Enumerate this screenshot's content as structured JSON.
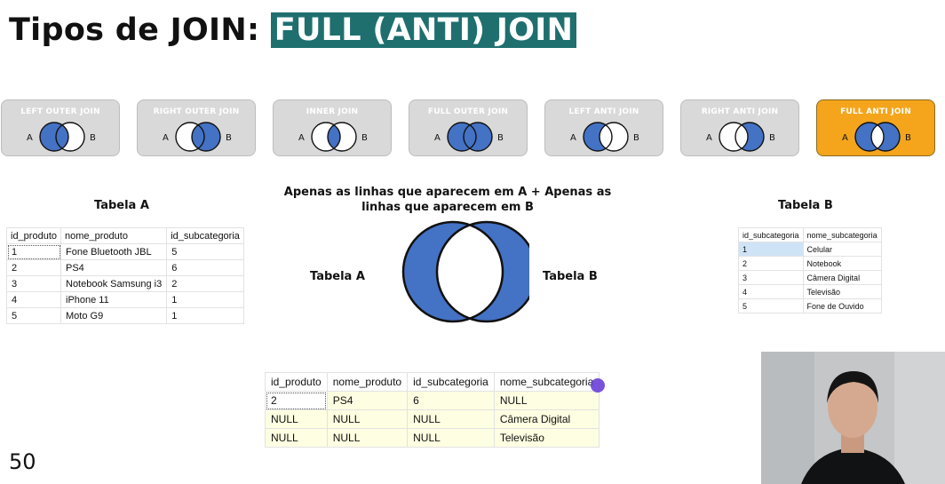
{
  "title": {
    "prefix": "Tipos de JOIN: ",
    "highlight": "FULL (ANTI) JOIN"
  },
  "join_types": [
    {
      "label": "LEFT OUTER JOIN",
      "a": "A",
      "b": "B"
    },
    {
      "label": "RIGHT OUTER JOIN",
      "a": "A",
      "b": "B"
    },
    {
      "label": "INNER JOIN",
      "a": "A",
      "b": "B"
    },
    {
      "label": "FULL OUTER JOIN",
      "a": "A",
      "b": "B"
    },
    {
      "label": "LEFT ANTI JOIN",
      "a": "A",
      "b": "B"
    },
    {
      "label": "RIGHT ANTI JOIN",
      "a": "A",
      "b": "B"
    },
    {
      "label": "FULL ANTI JOIN",
      "a": "A",
      "b": "B"
    }
  ],
  "colors": {
    "title_highlight": "#1f6f6f",
    "venn_fill": "#4472c4",
    "active_button": "#f4a51c",
    "inactive_button": "#d9d9d9"
  },
  "table_a": {
    "title": "Tabela A",
    "columns": [
      "id_produto",
      "nome_produto",
      "id_subcategoria"
    ],
    "rows": [
      [
        "1",
        "Fone Bluetooth JBL",
        "5"
      ],
      [
        "2",
        "PS4",
        "6"
      ],
      [
        "3",
        "Notebook Samsung i3",
        "2"
      ],
      [
        "4",
        "iPhone 11",
        "1"
      ],
      [
        "5",
        "Moto G9",
        "1"
      ]
    ]
  },
  "table_b": {
    "title": "Tabela B",
    "columns": [
      "id_subcategoria",
      "nome_subcategoria"
    ],
    "rows": [
      [
        "1",
        "Celular"
      ],
      [
        "2",
        "Notebook"
      ],
      [
        "3",
        "Câmera Digital"
      ],
      [
        "4",
        "Televisão"
      ],
      [
        "5",
        "Fone de Ouvido"
      ]
    ]
  },
  "venn": {
    "description": "Apenas as linhas que aparecem em A + Apenas as linhas que aparecem em B",
    "label_a": "Tabela A",
    "label_b": "Tabela B"
  },
  "result_table": {
    "columns": [
      "id_produto",
      "nome_produto",
      "id_subcategoria",
      "nome_subcategoria"
    ],
    "rows": [
      [
        "2",
        "PS4",
        "6",
        "NULL"
      ],
      [
        "NULL",
        "NULL",
        "NULL",
        "Câmera Digital"
      ],
      [
        "NULL",
        "NULL",
        "NULL",
        "Televisão"
      ]
    ]
  },
  "slide_number": "50"
}
